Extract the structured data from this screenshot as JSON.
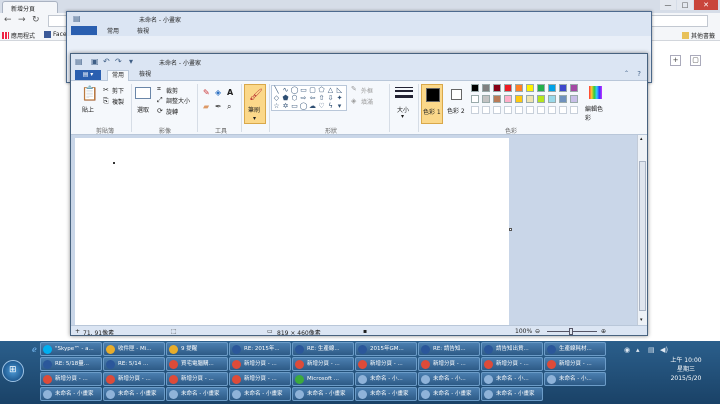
{
  "chrome": {
    "tab_title": "新增分頁",
    "controls": {
      "minimize": "—",
      "maximize": "□",
      "close": "✕"
    },
    "bookmarks": [
      {
        "label": "應用程式",
        "icon": "apps-icon"
      },
      {
        "label": "Face",
        "icon": "facebook-icon"
      }
    ],
    "other_bookmarks": "其他書籤"
  },
  "paint_bg": {
    "title": "未命名 - 小畫家",
    "tabs": [
      "常用",
      "檢視"
    ]
  },
  "paint": {
    "title": "未命名 - 小畫家",
    "tabs": {
      "home": "常用",
      "view": "檢視"
    },
    "clipboard": {
      "paste": "貼上",
      "cut": "剪下",
      "copy": "複製",
      "group": "剪貼簿"
    },
    "image": {
      "select": "選取",
      "crop": "裁剪",
      "resize": "調整大小",
      "rotate": "旋轉",
      "group": "影像"
    },
    "tools": {
      "group": "工具"
    },
    "brushes": {
      "label": "筆刷"
    },
    "shapes": {
      "outline": "外框",
      "fill": "填滿",
      "group": "形狀"
    },
    "size": {
      "label": "大小"
    },
    "colors": {
      "color1": "色彩 1",
      "color2": "色彩 2",
      "edit": "編輯色彩",
      "group": "色彩",
      "color1_value": "#000000",
      "color2_value": "#ffffff",
      "palette": [
        "#000000",
        "#7f7f7f",
        "#880015",
        "#ed1c24",
        "#ff7f27",
        "#fff200",
        "#22b14c",
        "#00a2e8",
        "#3f48cc",
        "#a349a4",
        "#ffffff",
        "#c3c3c3",
        "#b97a57",
        "#ffaec9",
        "#ffc90e",
        "#efe4b0",
        "#b5e61d",
        "#99d9ea",
        "#7092be",
        "#c8bfe7"
      ]
    },
    "status": {
      "cursor": "71, 91像素",
      "canvas_size": "819 × 460像素",
      "zoom": "100%"
    }
  },
  "taskbar": {
    "rows": [
      [
        {
          "label": "\"Skype™ - a...",
          "color": "#00aff0"
        },
        {
          "label": "收件匣 - Mi...",
          "color": "#e8ad2c"
        },
        {
          "label": "9 提醒",
          "color": "#e8ad2c"
        },
        {
          "label": "RE: 2015年...",
          "color": "#2b579a"
        },
        {
          "label": "RE: 生產線...",
          "color": "#2b579a"
        },
        {
          "label": "2015年GM...",
          "color": "#2b579a"
        },
        {
          "label": "RE: 請告知...",
          "color": "#2b579a"
        },
        {
          "label": "請告知出貨...",
          "color": "#2b579a"
        },
        {
          "label": "生產線耗材...",
          "color": "#2b579a"
        }
      ],
      [
        {
          "label": "RE: 5/18量...",
          "color": "#2b579a"
        },
        {
          "label": "RE: 5/14 ...",
          "color": "#2b579a"
        },
        {
          "label": "買宅電腦購...",
          "color": "#dd4b39"
        },
        {
          "label": "新增分頁 - ...",
          "color": "#dd4b39"
        },
        {
          "label": "新增分頁 - ...",
          "color": "#dd4b39"
        },
        {
          "label": "新增分頁 - ...",
          "color": "#dd4b39"
        },
        {
          "label": "新增分頁 - ...",
          "color": "#dd4b39"
        },
        {
          "label": "新增分頁 - ...",
          "color": "#dd4b39"
        },
        {
          "label": "新增分頁 - ...",
          "color": "#dd4b39"
        }
      ],
      [
        {
          "label": "新增分頁 - ...",
          "color": "#dd4b39"
        },
        {
          "label": "新增分頁 - ...",
          "color": "#dd4b39"
        },
        {
          "label": "新增分頁 - ...",
          "color": "#dd4b39"
        },
        {
          "label": "新增分頁 - ...",
          "color": "#dd4b39"
        },
        {
          "label": "Microsoft ...",
          "color": "#3cab3c"
        },
        {
          "label": "未命名 - 小...",
          "color": "#8fb3d9"
        },
        {
          "label": "未命名 - 小...",
          "color": "#8fb3d9"
        },
        {
          "label": "未命名 - 小...",
          "color": "#8fb3d9"
        },
        {
          "label": "未命名 - 小...",
          "color": "#8fb3d9"
        }
      ],
      [
        {
          "label": "未命名 - 小畫家",
          "color": "#8fb3d9"
        },
        {
          "label": "未命名 - 小畫家",
          "color": "#8fb3d9"
        },
        {
          "label": "未命名 - 小畫家",
          "color": "#8fb3d9"
        },
        {
          "label": "未命名 - 小畫家",
          "color": "#8fb3d9"
        },
        {
          "label": "未命名 - 小畫家",
          "color": "#8fb3d9"
        },
        {
          "label": "未命名 - 小畫家",
          "color": "#8fb3d9"
        },
        {
          "label": "未命名 - 小畫家",
          "color": "#8fb3d9"
        },
        {
          "label": "未命名 - 小畫家",
          "color": "#8fb3d9"
        }
      ]
    ],
    "clock": {
      "time": "上午 10:00",
      "weekday": "星期三",
      "date": "2015/5/20"
    }
  }
}
